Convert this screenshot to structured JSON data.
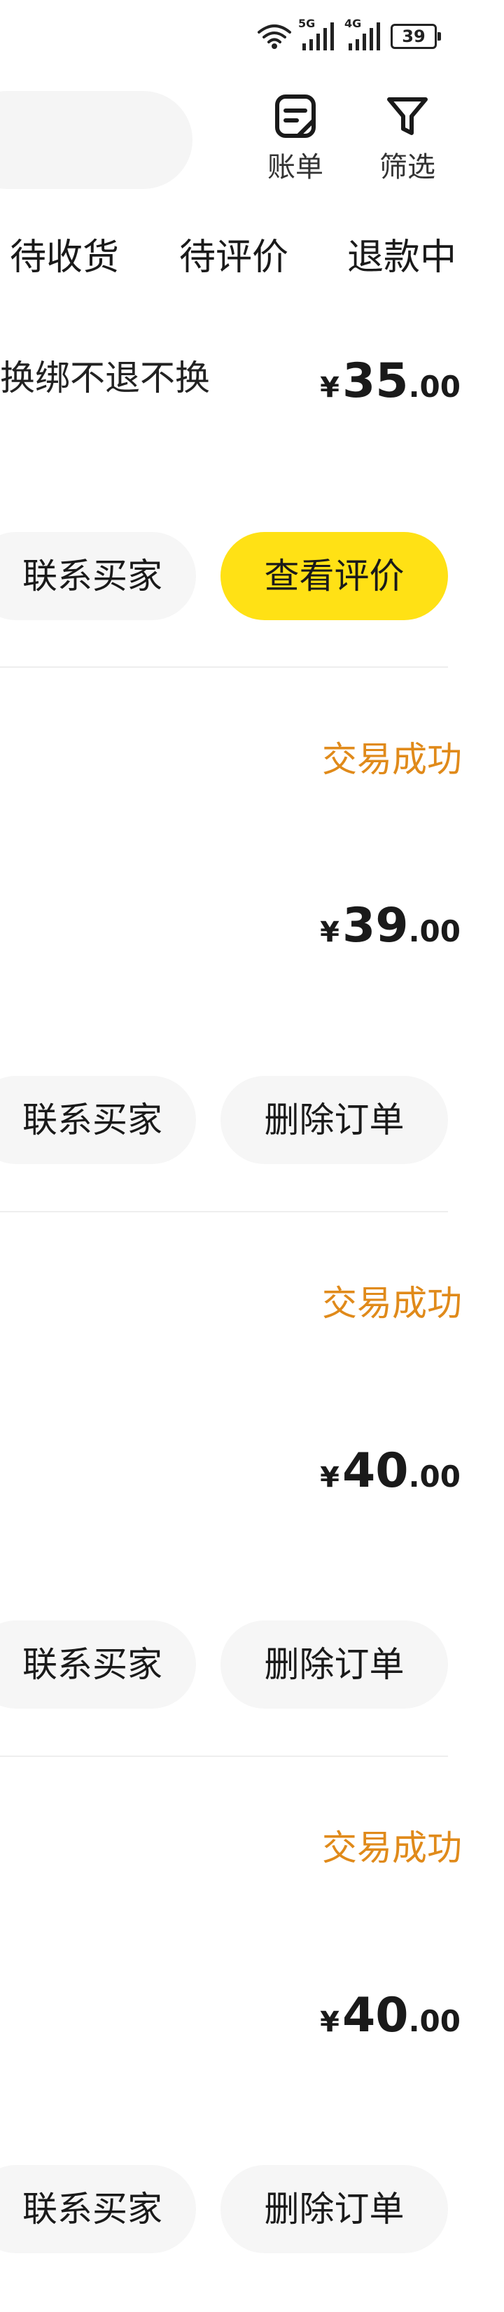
{
  "status_bar": {
    "net1": "5G",
    "net2": "4G",
    "battery": "39"
  },
  "header": {
    "bill_label": "账单",
    "filter_label": "筛选"
  },
  "tabs": [
    {
      "label": "待收货"
    },
    {
      "label": "待评价"
    },
    {
      "label": "退款中"
    }
  ],
  "orders": [
    {
      "title": "换绑不退不换",
      "price": {
        "currency": "¥",
        "integer": "35",
        "decimal": ".00"
      },
      "contact_label": "联系买家",
      "action_label": "查看评价"
    },
    {
      "status": "交易成功",
      "price": {
        "currency": "¥",
        "integer": "39",
        "decimal": ".00"
      },
      "contact_label": "联系买家",
      "action_label": "删除订单"
    },
    {
      "status": "交易成功",
      "price": {
        "currency": "¥",
        "integer": "40",
        "decimal": ".00"
      },
      "contact_label": "联系买家",
      "action_label": "删除订单"
    },
    {
      "status": "交易成功",
      "price": {
        "currency": "¥",
        "integer": "40",
        "decimal": ".00"
      },
      "contact_label": "联系买家",
      "action_label": "删除订单"
    }
  ],
  "colors": {
    "accent_yellow": "#ffe115",
    "status_orange": "#e08a1a"
  }
}
